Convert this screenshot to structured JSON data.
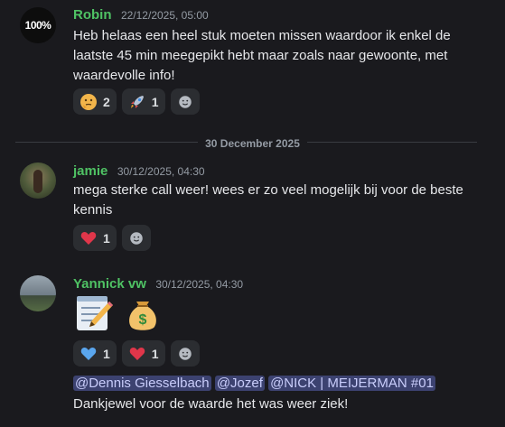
{
  "messages": [
    {
      "author": "Robin",
      "timestamp": "22/12/2025, 05:00",
      "avatar_text": "100%",
      "text": "Heb helaas een heel stuk moeten missen waardoor ik enkel de laatste 45 min meegepikt hebt maar zoals naar gewoonte, met waardevolle info!",
      "reactions": [
        {
          "emoji": "thinking-face",
          "count": "2"
        },
        {
          "emoji": "rocket",
          "count": "1"
        }
      ]
    },
    {
      "author": "jamie",
      "timestamp": "30/12/2025, 04:30",
      "text": "mega sterke call weer! wees er zo veel mogelijk bij voor de beste kennis",
      "reactions": [
        {
          "emoji": "red-heart",
          "count": "1"
        }
      ]
    },
    {
      "author": "Yannick vw",
      "timestamp": "30/12/2025, 04:30",
      "big_emojis": [
        "memo",
        "money-bag"
      ],
      "reactions": [
        {
          "emoji": "blue-heart",
          "count": "1"
        },
        {
          "emoji": "red-heart",
          "count": "1"
        }
      ],
      "mentions": [
        "@Dennis Giesselbach",
        "@Jozef",
        "@NICK | MEIJERMAN #01"
      ],
      "text": "Dankjewel voor de waarde het was weer ziek!"
    }
  ],
  "date_divider": "30 December 2025",
  "colors": {
    "background": "#1a1a1e",
    "username": "#4fc264",
    "mention_bg": "#3c4270",
    "reaction_bg": "#2b2d31"
  }
}
